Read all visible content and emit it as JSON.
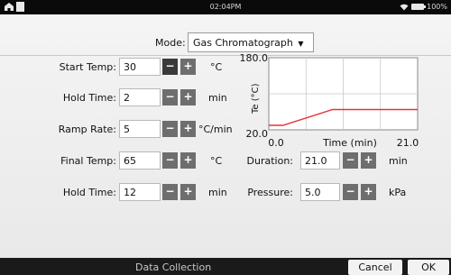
{
  "status": {
    "time": "02:04PM",
    "battery": "100%"
  },
  "mode": {
    "label": "Mode:",
    "value": "Gas Chromatograph",
    "options": [
      "Gas Chromatograph"
    ]
  },
  "form": {
    "start_temp": {
      "label": "Start Temp:",
      "value": "30",
      "unit": "°C"
    },
    "hold_time_1": {
      "label": "Hold Time:",
      "value": "2",
      "unit": "min"
    },
    "ramp_rate": {
      "label": "Ramp Rate:",
      "value": "5",
      "unit": "°C/min"
    },
    "final_temp": {
      "label": "Final Temp:",
      "value": "65",
      "unit": "°C"
    },
    "hold_time_2": {
      "label": "Hold Time:",
      "value": "12",
      "unit": "min"
    },
    "duration": {
      "label": "Duration:",
      "value": "21.0",
      "unit": "min"
    },
    "pressure": {
      "label": "Pressure:",
      "value": "5.0",
      "unit": "kPa"
    },
    "minus": "−",
    "plus": "+"
  },
  "chart_data": {
    "type": "line",
    "xlabel": "Time (min)",
    "ylabel": "Te (°C)",
    "xlim": [
      0.0,
      21.0
    ],
    "ylim": [
      20.0,
      180.0
    ],
    "x_ticks": [
      "0.0",
      "21.0"
    ],
    "y_ticks": [
      "180.0",
      "20.0"
    ],
    "grid": true,
    "series": [
      {
        "x": [
          0,
          2,
          9,
          21
        ],
        "y": [
          30,
          30,
          65,
          65
        ],
        "color": "#e8323c"
      }
    ]
  },
  "footer": {
    "title": "Data Collection",
    "cancel": "Cancel",
    "ok": "OK"
  },
  "colors": {
    "line": "#e8323c",
    "stepper": "#6e6e6e",
    "stepper_dark": "#3a3a3a"
  }
}
